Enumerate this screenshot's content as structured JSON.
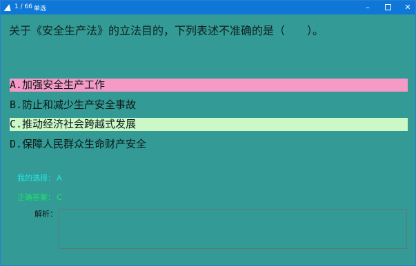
{
  "titlebar": {
    "counter": "1 / 66",
    "question_type": "单选",
    "minimize": "–",
    "close": "✕"
  },
  "question": {
    "text": "关于《安全生产法》的立法目的，下列表述不准确的是（　　）。"
  },
  "options": [
    {
      "text": "A.加强安全生产工作",
      "state": "selected"
    },
    {
      "text": "B.防止和减少生产安全事故",
      "state": "normal"
    },
    {
      "text": "C.推动经济社会跨越式发展",
      "state": "correct"
    },
    {
      "text": "D.保障人民群众生命财产安全",
      "state": "normal"
    }
  ],
  "result": {
    "my_choice_label": "我的选择：",
    "my_choice_value": "A",
    "correct_label": "正确答案：",
    "correct_value": "C"
  },
  "analysis": {
    "label": "解析：",
    "content": ""
  },
  "colors": {
    "background": "#339a95",
    "titlebar": "#0e77d8",
    "selected_wrong": "#f59ac7",
    "correct_answer": "#ccf7c7",
    "my_choice_text": "#22e8e8",
    "correct_text": "#22e06a"
  }
}
